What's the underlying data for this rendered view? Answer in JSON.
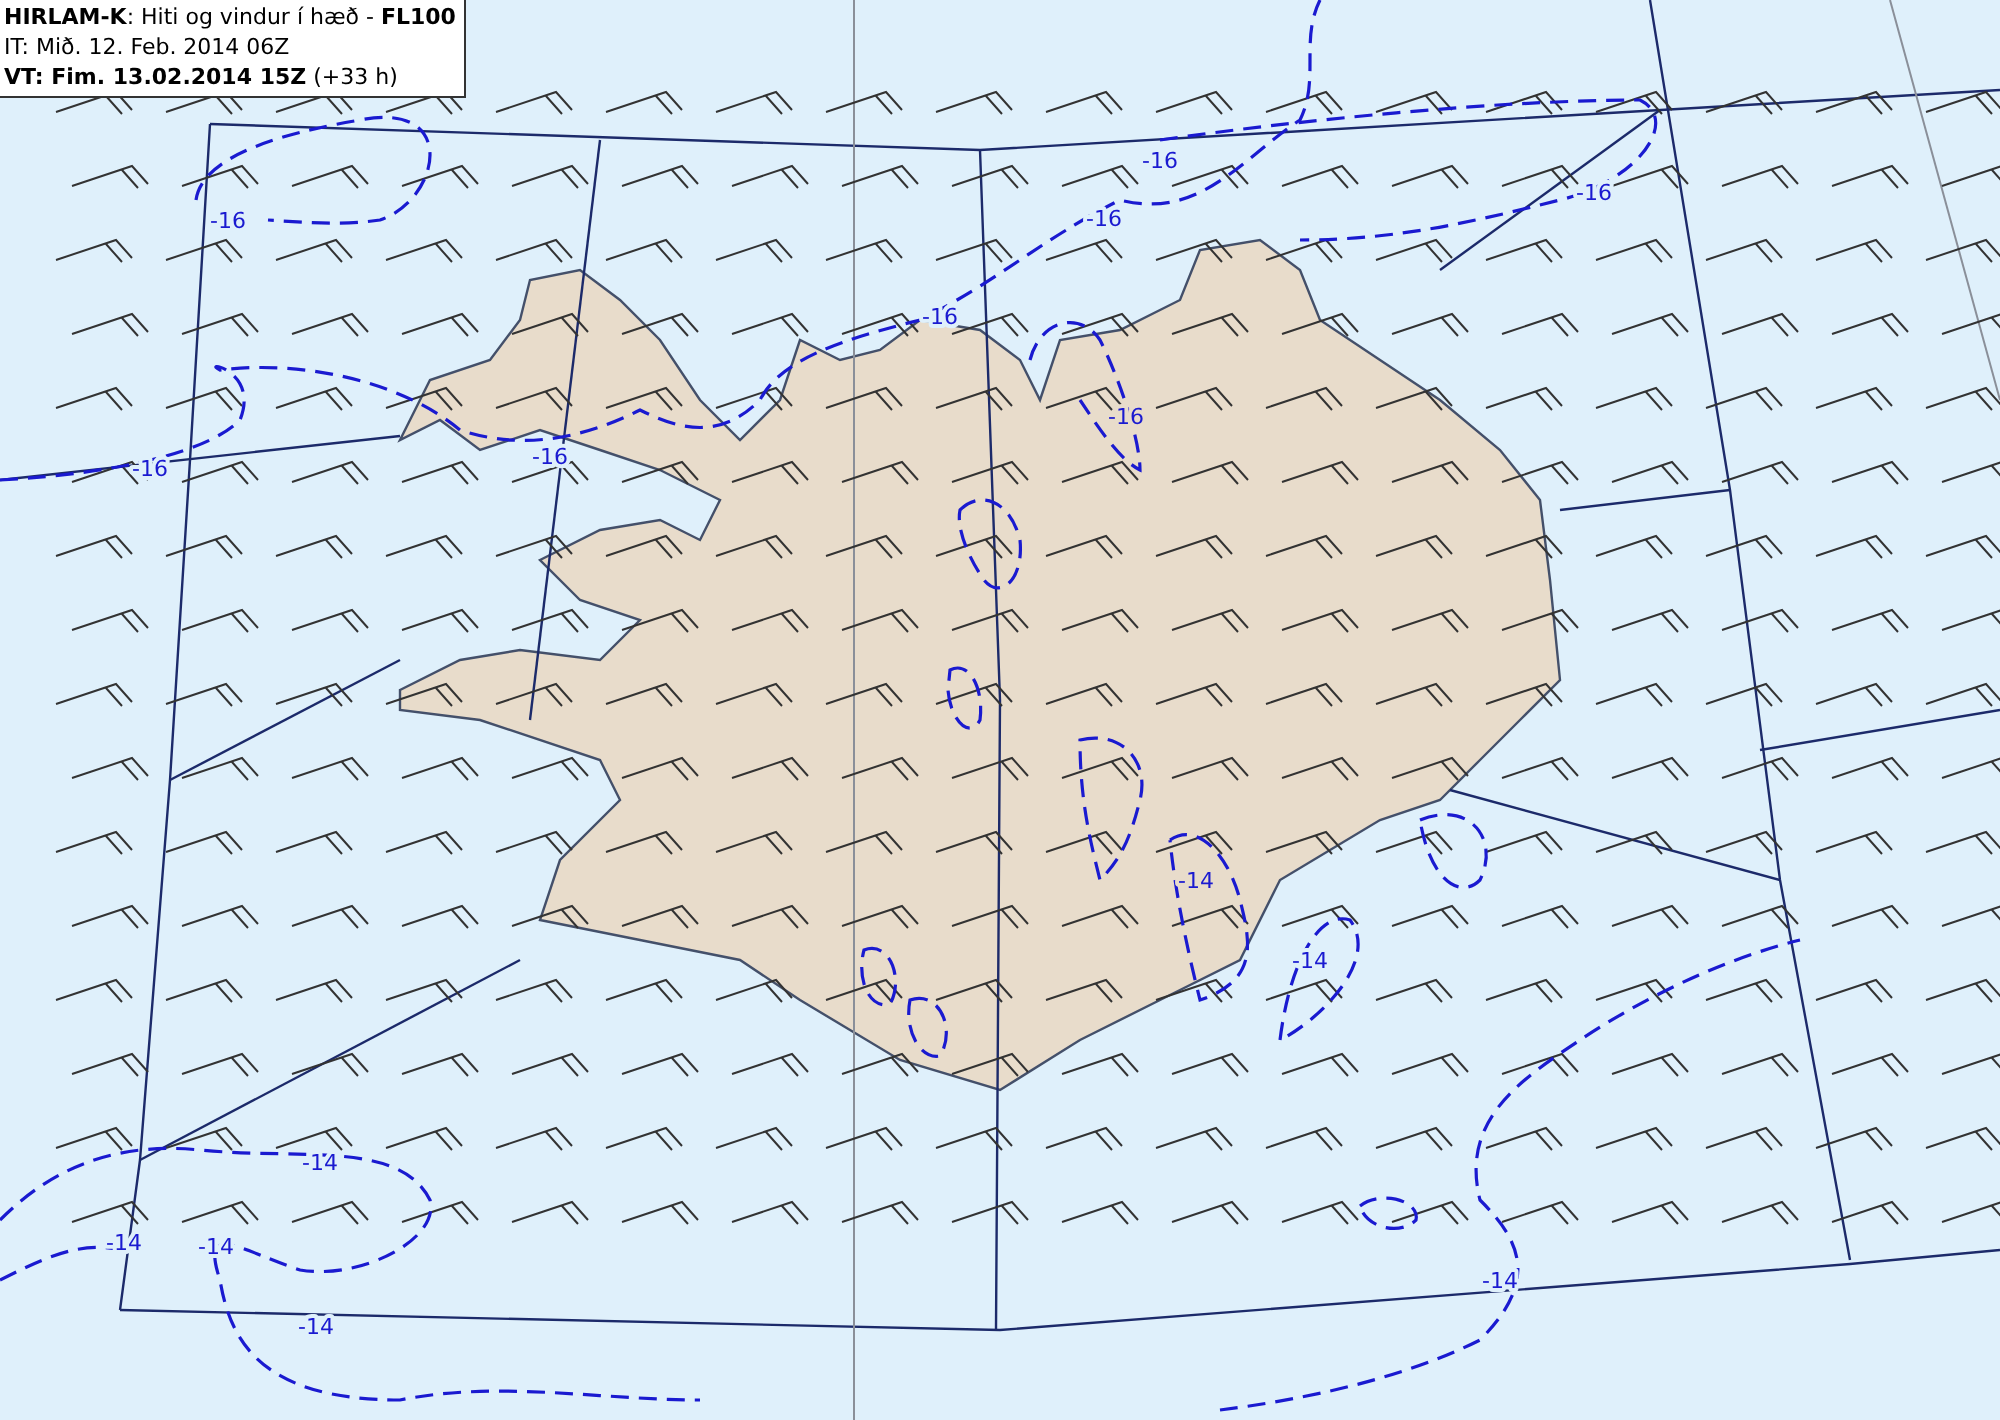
{
  "legend": {
    "lines": [
      "**HIRLAM-K**: Hiti og vindur í hæð - **FL100**",
      "IT: Mið. 12. Feb. 2014 06Z",
      "**VT: Fim. 13.02.2014 15Z** (+33 h)"
    ]
  },
  "isotherm_labels": [
    "-16",
    "-16",
    "-16",
    "-16",
    "-16",
    "-16",
    "-16",
    "-16",
    "-14",
    "-14",
    "-14",
    "-14",
    "-14",
    "-14",
    "-14"
  ]
}
